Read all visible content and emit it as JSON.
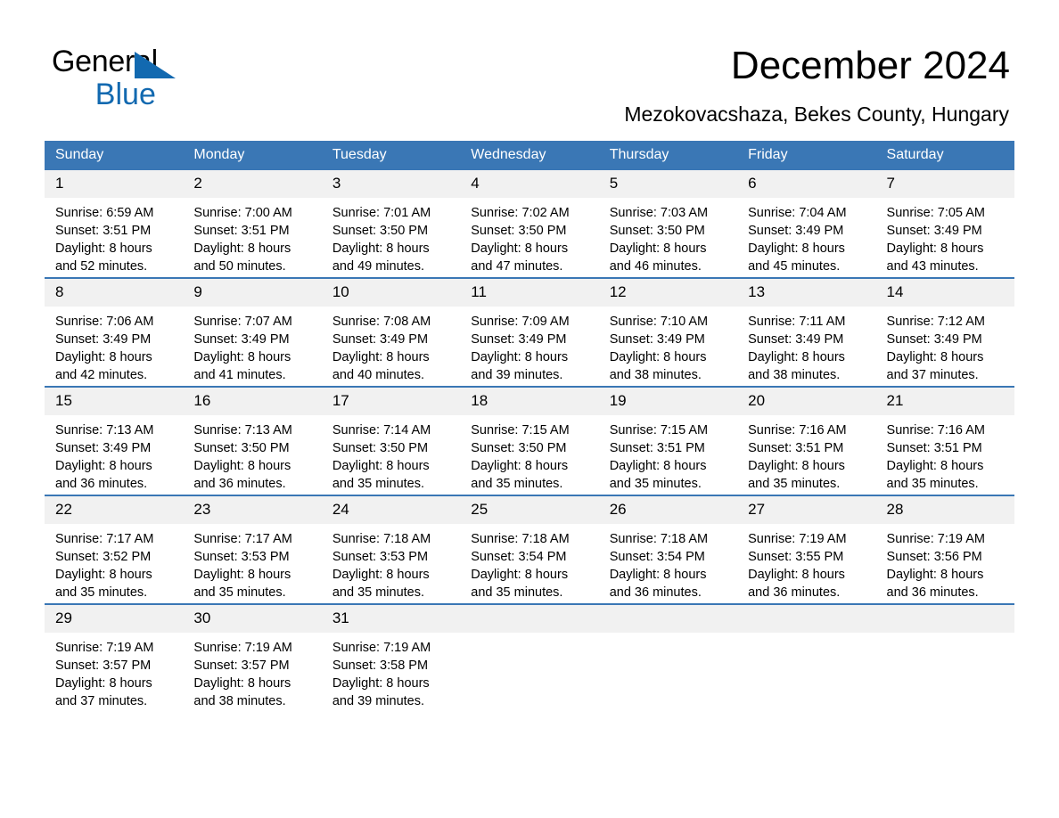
{
  "brand": {
    "name_part1": "General",
    "name_part2": "Blue",
    "triangle_icon": "triangle-icon",
    "color_black": "#000000",
    "color_blue": "#1269b0"
  },
  "header": {
    "title": "December 2024",
    "subtitle": "Mezokovacshaza, Bekes County, Hungary"
  },
  "theme": {
    "header_blue": "#3a77b5",
    "daynum_gray": "#f1f1f1",
    "text_black": "#000000",
    "header_text": "#ffffff"
  },
  "calendar": {
    "weekday_headers": [
      "Sunday",
      "Monday",
      "Tuesday",
      "Wednesday",
      "Thursday",
      "Friday",
      "Saturday"
    ],
    "weeks": [
      [
        {
          "day": "1",
          "sunrise": "Sunrise: 6:59 AM",
          "sunset": "Sunset: 3:51 PM",
          "daylight_line1": "Daylight: 8 hours",
          "daylight_line2": "and 52 minutes."
        },
        {
          "day": "2",
          "sunrise": "Sunrise: 7:00 AM",
          "sunset": "Sunset: 3:51 PM",
          "daylight_line1": "Daylight: 8 hours",
          "daylight_line2": "and 50 minutes."
        },
        {
          "day": "3",
          "sunrise": "Sunrise: 7:01 AM",
          "sunset": "Sunset: 3:50 PM",
          "daylight_line1": "Daylight: 8 hours",
          "daylight_line2": "and 49 minutes."
        },
        {
          "day": "4",
          "sunrise": "Sunrise: 7:02 AM",
          "sunset": "Sunset: 3:50 PM",
          "daylight_line1": "Daylight: 8 hours",
          "daylight_line2": "and 47 minutes."
        },
        {
          "day": "5",
          "sunrise": "Sunrise: 7:03 AM",
          "sunset": "Sunset: 3:50 PM",
          "daylight_line1": "Daylight: 8 hours",
          "daylight_line2": "and 46 minutes."
        },
        {
          "day": "6",
          "sunrise": "Sunrise: 7:04 AM",
          "sunset": "Sunset: 3:49 PM",
          "daylight_line1": "Daylight: 8 hours",
          "daylight_line2": "and 45 minutes."
        },
        {
          "day": "7",
          "sunrise": "Sunrise: 7:05 AM",
          "sunset": "Sunset: 3:49 PM",
          "daylight_line1": "Daylight: 8 hours",
          "daylight_line2": "and 43 minutes."
        }
      ],
      [
        {
          "day": "8",
          "sunrise": "Sunrise: 7:06 AM",
          "sunset": "Sunset: 3:49 PM",
          "daylight_line1": "Daylight: 8 hours",
          "daylight_line2": "and 42 minutes."
        },
        {
          "day": "9",
          "sunrise": "Sunrise: 7:07 AM",
          "sunset": "Sunset: 3:49 PM",
          "daylight_line1": "Daylight: 8 hours",
          "daylight_line2": "and 41 minutes."
        },
        {
          "day": "10",
          "sunrise": "Sunrise: 7:08 AM",
          "sunset": "Sunset: 3:49 PM",
          "daylight_line1": "Daylight: 8 hours",
          "daylight_line2": "and 40 minutes."
        },
        {
          "day": "11",
          "sunrise": "Sunrise: 7:09 AM",
          "sunset": "Sunset: 3:49 PM",
          "daylight_line1": "Daylight: 8 hours",
          "daylight_line2": "and 39 minutes."
        },
        {
          "day": "12",
          "sunrise": "Sunrise: 7:10 AM",
          "sunset": "Sunset: 3:49 PM",
          "daylight_line1": "Daylight: 8 hours",
          "daylight_line2": "and 38 minutes."
        },
        {
          "day": "13",
          "sunrise": "Sunrise: 7:11 AM",
          "sunset": "Sunset: 3:49 PM",
          "daylight_line1": "Daylight: 8 hours",
          "daylight_line2": "and 38 minutes."
        },
        {
          "day": "14",
          "sunrise": "Sunrise: 7:12 AM",
          "sunset": "Sunset: 3:49 PM",
          "daylight_line1": "Daylight: 8 hours",
          "daylight_line2": "and 37 minutes."
        }
      ],
      [
        {
          "day": "15",
          "sunrise": "Sunrise: 7:13 AM",
          "sunset": "Sunset: 3:49 PM",
          "daylight_line1": "Daylight: 8 hours",
          "daylight_line2": "and 36 minutes."
        },
        {
          "day": "16",
          "sunrise": "Sunrise: 7:13 AM",
          "sunset": "Sunset: 3:50 PM",
          "daylight_line1": "Daylight: 8 hours",
          "daylight_line2": "and 36 minutes."
        },
        {
          "day": "17",
          "sunrise": "Sunrise: 7:14 AM",
          "sunset": "Sunset: 3:50 PM",
          "daylight_line1": "Daylight: 8 hours",
          "daylight_line2": "and 35 minutes."
        },
        {
          "day": "18",
          "sunrise": "Sunrise: 7:15 AM",
          "sunset": "Sunset: 3:50 PM",
          "daylight_line1": "Daylight: 8 hours",
          "daylight_line2": "and 35 minutes."
        },
        {
          "day": "19",
          "sunrise": "Sunrise: 7:15 AM",
          "sunset": "Sunset: 3:51 PM",
          "daylight_line1": "Daylight: 8 hours",
          "daylight_line2": "and 35 minutes."
        },
        {
          "day": "20",
          "sunrise": "Sunrise: 7:16 AM",
          "sunset": "Sunset: 3:51 PM",
          "daylight_line1": "Daylight: 8 hours",
          "daylight_line2": "and 35 minutes."
        },
        {
          "day": "21",
          "sunrise": "Sunrise: 7:16 AM",
          "sunset": "Sunset: 3:51 PM",
          "daylight_line1": "Daylight: 8 hours",
          "daylight_line2": "and 35 minutes."
        }
      ],
      [
        {
          "day": "22",
          "sunrise": "Sunrise: 7:17 AM",
          "sunset": "Sunset: 3:52 PM",
          "daylight_line1": "Daylight: 8 hours",
          "daylight_line2": "and 35 minutes."
        },
        {
          "day": "23",
          "sunrise": "Sunrise: 7:17 AM",
          "sunset": "Sunset: 3:53 PM",
          "daylight_line1": "Daylight: 8 hours",
          "daylight_line2": "and 35 minutes."
        },
        {
          "day": "24",
          "sunrise": "Sunrise: 7:18 AM",
          "sunset": "Sunset: 3:53 PM",
          "daylight_line1": "Daylight: 8 hours",
          "daylight_line2": "and 35 minutes."
        },
        {
          "day": "25",
          "sunrise": "Sunrise: 7:18 AM",
          "sunset": "Sunset: 3:54 PM",
          "daylight_line1": "Daylight: 8 hours",
          "daylight_line2": "and 35 minutes."
        },
        {
          "day": "26",
          "sunrise": "Sunrise: 7:18 AM",
          "sunset": "Sunset: 3:54 PM",
          "daylight_line1": "Daylight: 8 hours",
          "daylight_line2": "and 36 minutes."
        },
        {
          "day": "27",
          "sunrise": "Sunrise: 7:19 AM",
          "sunset": "Sunset: 3:55 PM",
          "daylight_line1": "Daylight: 8 hours",
          "daylight_line2": "and 36 minutes."
        },
        {
          "day": "28",
          "sunrise": "Sunrise: 7:19 AM",
          "sunset": "Sunset: 3:56 PM",
          "daylight_line1": "Daylight: 8 hours",
          "daylight_line2": "and 36 minutes."
        }
      ],
      [
        {
          "day": "29",
          "sunrise": "Sunrise: 7:19 AM",
          "sunset": "Sunset: 3:57 PM",
          "daylight_line1": "Daylight: 8 hours",
          "daylight_line2": "and 37 minutes."
        },
        {
          "day": "30",
          "sunrise": "Sunrise: 7:19 AM",
          "sunset": "Sunset: 3:57 PM",
          "daylight_line1": "Daylight: 8 hours",
          "daylight_line2": "and 38 minutes."
        },
        {
          "day": "31",
          "sunrise": "Sunrise: 7:19 AM",
          "sunset": "Sunset: 3:58 PM",
          "daylight_line1": "Daylight: 8 hours",
          "daylight_line2": "and 39 minutes."
        },
        {
          "day": "",
          "sunrise": "",
          "sunset": "",
          "daylight_line1": "",
          "daylight_line2": ""
        },
        {
          "day": "",
          "sunrise": "",
          "sunset": "",
          "daylight_line1": "",
          "daylight_line2": ""
        },
        {
          "day": "",
          "sunrise": "",
          "sunset": "",
          "daylight_line1": "",
          "daylight_line2": ""
        },
        {
          "day": "",
          "sunrise": "",
          "sunset": "",
          "daylight_line1": "",
          "daylight_line2": ""
        }
      ]
    ]
  }
}
